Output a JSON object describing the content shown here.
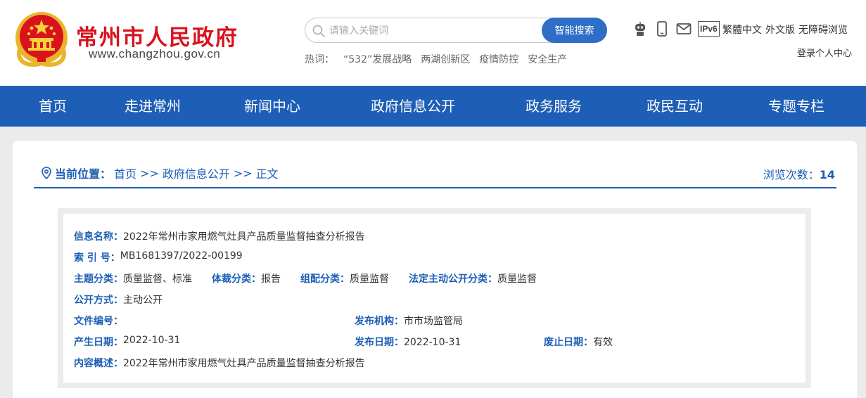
{
  "header": {
    "site_title": "常州市人民政府",
    "site_url": "www.changzhou.gov.cn",
    "search": {
      "placeholder": "请输入关键词",
      "button_label": "智能搜索"
    },
    "hotwords": {
      "label": "热词：",
      "items": [
        "“532”发展战略",
        "两湖创新区",
        "疫情防控",
        "安全生产"
      ]
    },
    "tool_icons": [
      "robot-icon",
      "mobile-icon",
      "mail-icon",
      "ipv6-icon"
    ],
    "ipv6_label": "IPv6",
    "links": [
      "繁體中文",
      "外文版",
      "无障碍浏览"
    ],
    "login_label": "登录个人中心"
  },
  "nav": {
    "items": [
      "首页",
      "走进常州",
      "新闻中心",
      "政府信息公开",
      "政务服务",
      "政民互动",
      "专题专栏"
    ]
  },
  "breadcrumb": {
    "label": "当前位置：",
    "items": [
      "首页",
      "政府信息公开",
      "正文"
    ],
    "separator": ">>"
  },
  "views": {
    "label": "浏览次数：",
    "count": "14"
  },
  "info": {
    "name_label": "信息名称：",
    "name_value": "2022年常州市家用燃气灶具产品质量监督抽查分析报告",
    "index_label": "索 引 号：",
    "index_value": "MB1681397/2022-00199",
    "topic_label": "主题分类：",
    "topic_value": "质量监督、标准",
    "genre_label": "体裁分类：",
    "genre_value": "报告",
    "org_label": "组配分类：",
    "org_value": "质量监督",
    "legal_label": "法定主动公开分类：",
    "legal_value": "质量监督",
    "method_label": "公开方式：",
    "method_value": "主动公开",
    "docno_label": "文件编号：",
    "docno_value": "",
    "publisher_label": "发布机构：",
    "publisher_value": "市市场监管局",
    "created_label": "产生日期：",
    "created_value": "2022-10-31",
    "published_label": "发布日期：",
    "published_value": "2022-10-31",
    "expiry_label": "废止日期：",
    "expiry_value": "有效",
    "summary_label": "内容概述：",
    "summary_value": "2022年常州市家用燃气灶具产品质量监督抽查分析报告"
  },
  "colors": {
    "brand_red": "#d9121e",
    "nav_blue": "#1d5eb6",
    "search_blue": "#2f6ec6"
  }
}
